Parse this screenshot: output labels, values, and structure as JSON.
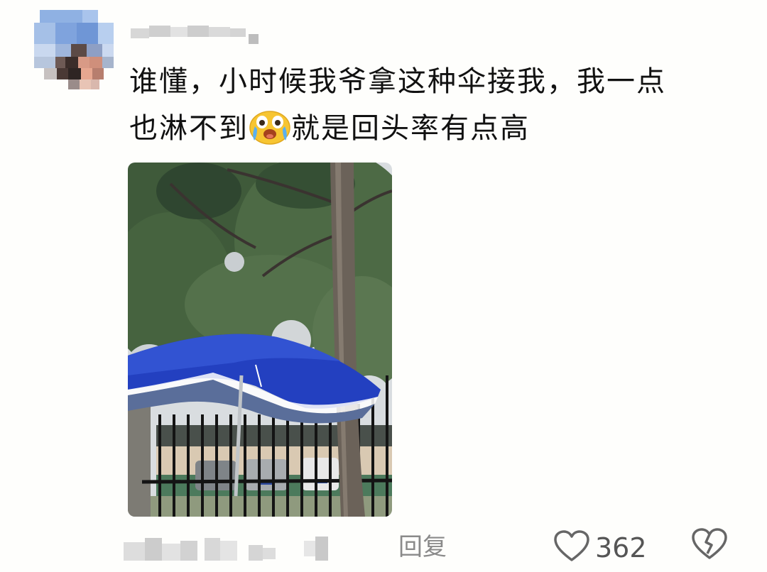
{
  "comment": {
    "username_blurred": true,
    "text_line1": "谁懂，小时候我爷拿这种伞接我，我一点",
    "text_line2_before_emoji": "也淋不到",
    "emoji": "crying-laughing-emoji",
    "text_line2_after_emoji": "就是回头率有点高",
    "photo": "umbrella-photo"
  },
  "footer": {
    "reply_label": "回复",
    "like_count": "362",
    "like_icon": "heart-icon",
    "dislike_icon": "broken-heart-icon"
  },
  "colors": {
    "umbrella_blue": "#1f3fb8",
    "text": "#111111",
    "meta_gray": "#8a8a8a"
  }
}
